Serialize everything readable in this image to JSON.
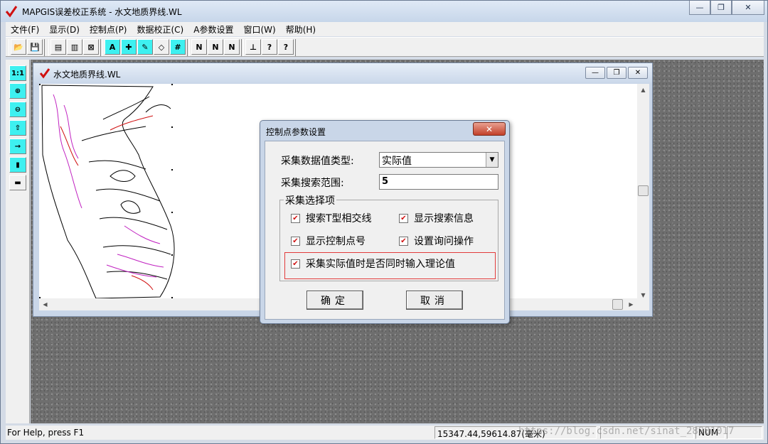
{
  "app": {
    "title": "MAPGIS误差校正系统 - 水文地质界线.WL",
    "window_buttons": {
      "minimize": "—",
      "restore": "❐",
      "close": "✕"
    }
  },
  "menu": [
    "文件(F)",
    "显示(D)",
    "控制点(P)",
    "数据校正(C)",
    "A参数设置",
    "窗口(W)",
    "帮助(H)"
  ],
  "toolbar": {
    "groups": [
      [
        "open-icon",
        "save-icon"
      ],
      [
        "copy-window-icon",
        "paste-window-icon",
        "close-window-icon"
      ],
      [
        "add-point-icon",
        "target-point-icon",
        "edit-point-icon",
        "erase-point-icon",
        "grid-icon"
      ],
      [
        "na-icon",
        "nl-icon",
        "no-icon"
      ],
      [
        "bar-chart-icon",
        "help-icon",
        "context-help-icon"
      ]
    ],
    "labels": [
      "📂",
      "💾",
      "▤",
      "▥",
      "⊠",
      "A",
      "✚",
      "✎",
      "◇",
      "#",
      "N",
      "N",
      "N",
      "⊥",
      "?",
      "?"
    ]
  },
  "left_tools": [
    "1:1",
    "⊕",
    "⊖",
    "⇧",
    "→",
    "▮",
    "▬"
  ],
  "document": {
    "title": "水文地质界线.WL"
  },
  "dialog": {
    "title": "控制点参数设置",
    "close": "✕",
    "data_type_label": "采集数据值类型:",
    "data_type_value": "实际值",
    "search_range_label": "采集搜索范围:",
    "search_range_value": "5",
    "group_label": "采集选择项",
    "options": [
      {
        "label": "搜索T型相交线",
        "checked": true
      },
      {
        "label": "显示搜索信息",
        "checked": true
      },
      {
        "label": "显示控制点号",
        "checked": true
      },
      {
        "label": "设置询问操作",
        "checked": true
      },
      {
        "label": "采集实际值时是否同时输入理论值",
        "checked": true
      }
    ],
    "ok": "确定",
    "cancel": "取消"
  },
  "status": {
    "help": "For Help, press F1",
    "coords": "15347.44,59614.87(毫米)",
    "num": "NUM",
    "watermark": "https://blog.csdn.net/sinat_28981017"
  },
  "colors": {
    "accent": "#3ef0f0",
    "highlight": "#e23b3b",
    "check": "#d01010"
  }
}
